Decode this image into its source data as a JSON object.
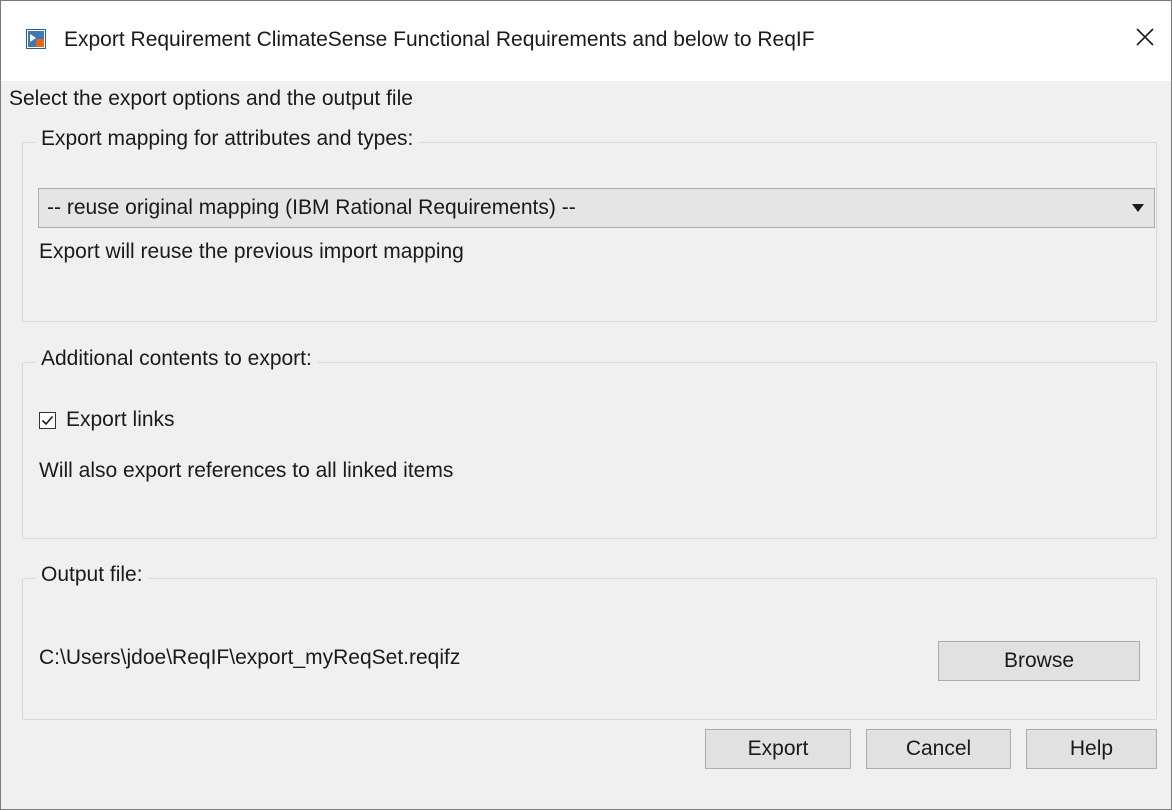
{
  "window": {
    "title": "Export Requirement ClimateSense Functional Requirements and below to ReqIF",
    "app_icon": "simulink-icon",
    "close_icon": "close-icon"
  },
  "instructions": "Select the export options and the output file",
  "mapping_group": {
    "legend": "Export mapping for attributes and types:",
    "selected": "-- reuse original mapping (IBM Rational Requirements) --",
    "hint": "Export will reuse the previous import mapping"
  },
  "additional_group": {
    "legend": "Additional contents to export:",
    "export_links_label": "Export links",
    "export_links_checked": true,
    "hint": "Will also export references to all linked items"
  },
  "output_group": {
    "legend": "Output file:",
    "path": "C:\\Users\\jdoe\\ReqIF\\export_myReqSet.reqifz",
    "browse_label": "Browse"
  },
  "footer": {
    "export_label": "Export",
    "cancel_label": "Cancel",
    "help_label": "Help"
  }
}
